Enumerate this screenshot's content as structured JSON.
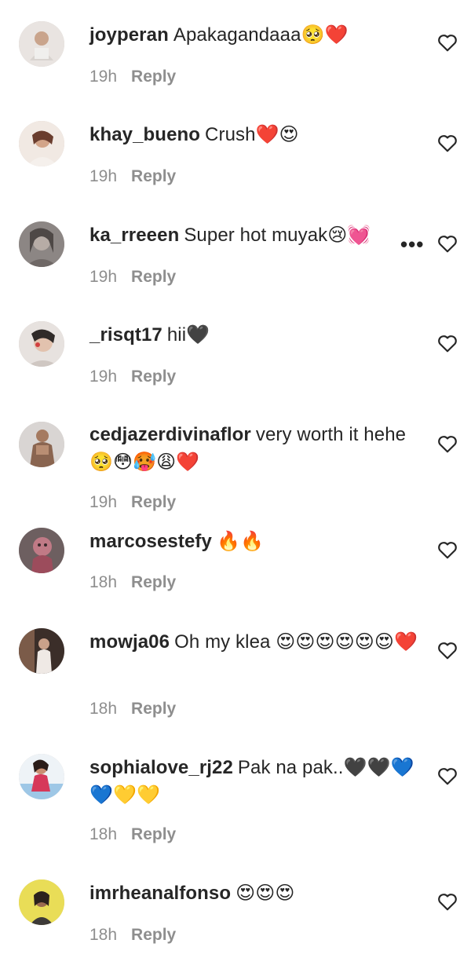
{
  "comments": [
    {
      "user": "joyperan",
      "text": "Apakagandaaa",
      "emoji": "🥺❤️",
      "time": "19h",
      "reply": "Reply"
    },
    {
      "user": "khay_bueno",
      "text": "Crush",
      "emoji": "❤️😍",
      "time": "19h",
      "reply": "Reply"
    },
    {
      "user": "ka_rreeen",
      "text": "Super hot muyak",
      "emoji": "😢💓",
      "time": "19h",
      "reply": "Reply",
      "more": "•••"
    },
    {
      "user": "_risqt17",
      "text": "hii",
      "emoji": "🖤",
      "time": "19h",
      "reply": "Reply"
    },
    {
      "user": "cedjazerdivinaflor",
      "text": "very worth it hehe",
      "emoji": "🥺😳🥵😩❤️",
      "time": "19h",
      "reply": "Reply"
    },
    {
      "user": "marcosestefy",
      "text": "",
      "emoji": "🔥🔥",
      "time": "18h",
      "reply": "Reply"
    },
    {
      "user": "mowja06",
      "text": "Oh my klea",
      "emoji": "😍😍😍😍😍😍❤️",
      "time": "18h",
      "reply": "Reply"
    },
    {
      "user": "sophialove_rj22",
      "text": "Pak na pak..",
      "emoji": "🖤🖤💙💙💛💛",
      "time": "18h",
      "reply": "Reply"
    },
    {
      "user": "imrheanalfonso",
      "text": "",
      "emoji": "😍😍😍",
      "time": "18h",
      "reply": "Reply"
    }
  ],
  "icons": {
    "like": "heart-outline-icon",
    "more": "more-options-icon"
  },
  "colors": {
    "text": "#262626",
    "secondary": "#8e8e8e",
    "background": "#ffffff"
  }
}
